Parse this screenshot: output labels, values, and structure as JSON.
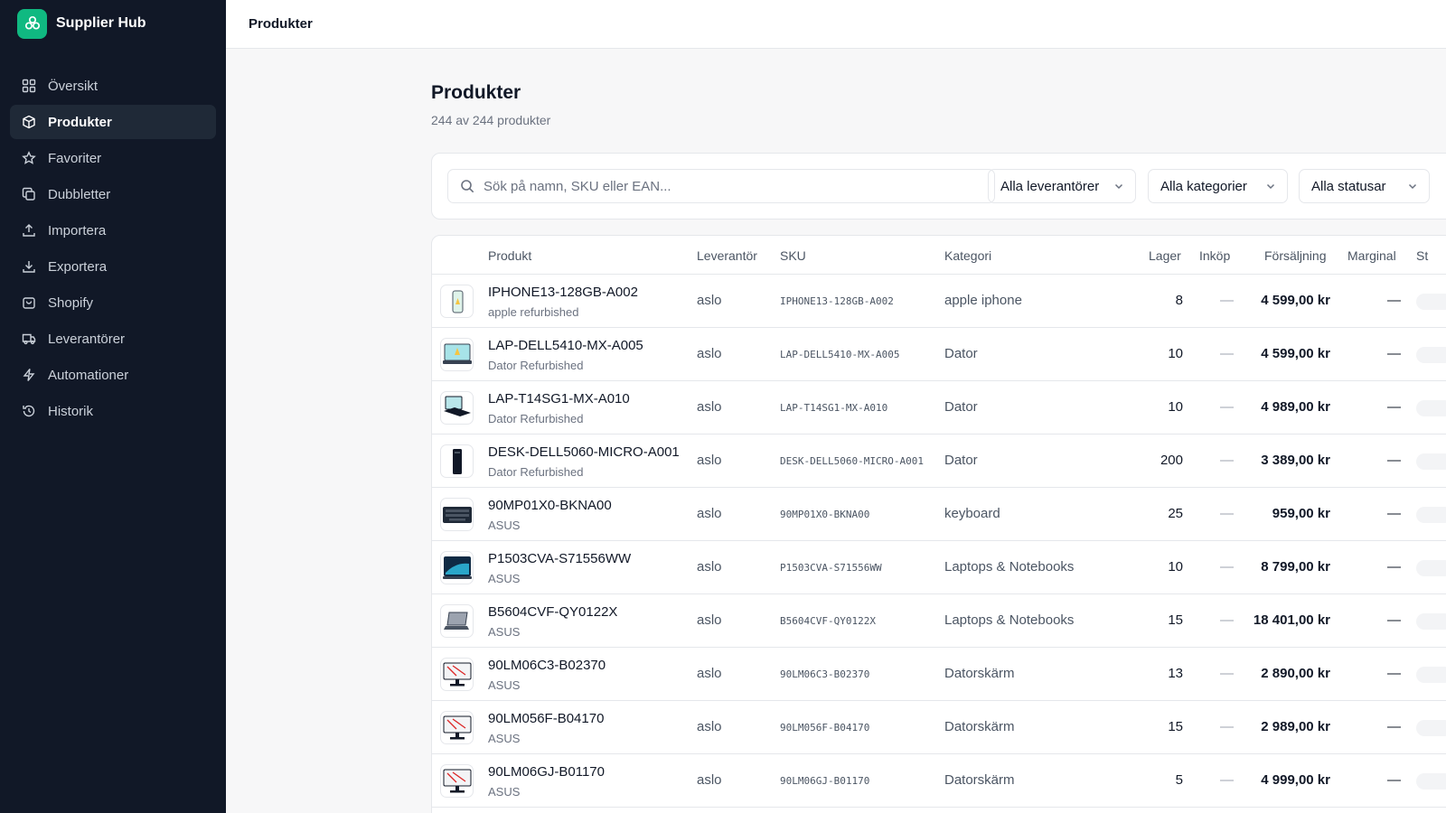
{
  "brand": {
    "name": "Supplier Hub"
  },
  "nav": [
    {
      "label": "Översikt",
      "icon": "grid-icon",
      "active": false
    },
    {
      "label": "Produkter",
      "icon": "package-icon",
      "active": true
    },
    {
      "label": "Favoriter",
      "icon": "star-icon",
      "active": false
    },
    {
      "label": "Dubbletter",
      "icon": "copy-icon",
      "active": false
    },
    {
      "label": "Importera",
      "icon": "upload-icon",
      "active": false
    },
    {
      "label": "Exportera",
      "icon": "download-icon",
      "active": false
    },
    {
      "label": "Shopify",
      "icon": "shopping-bag-icon",
      "active": false
    },
    {
      "label": "Leverantörer",
      "icon": "truck-icon",
      "active": false
    },
    {
      "label": "Automationer",
      "icon": "zap-icon",
      "active": false
    },
    {
      "label": "Historik",
      "icon": "history-icon",
      "active": false
    }
  ],
  "topbar": {
    "title": "Produkter"
  },
  "page": {
    "title": "Produkter",
    "subtitle": "244 av 244 produkter"
  },
  "filters": {
    "search_placeholder": "Sök på namn, SKU eller EAN...",
    "supplier": "Alla leverantörer",
    "category": "Alla kategorier",
    "status": "Alla statusar"
  },
  "columns": {
    "product": "Produkt",
    "supplier": "Leverantör",
    "sku": "SKU",
    "category": "Kategori",
    "stock": "Lager",
    "purchase": "Inköp",
    "price": "Försäljning",
    "margin": "Marginal",
    "status": "St"
  },
  "rows": [
    {
      "name": "IPHONE13-128GB-A002",
      "brand": "apple refurbished",
      "supplier": "aslo",
      "sku": "IPHONE13-128GB-A002",
      "category": "apple iphone",
      "stock": "8",
      "purchase": "—",
      "price": "4 599,00 kr",
      "margin": "—",
      "thumb": "phone"
    },
    {
      "name": "LAP-DELL5410-MX-A005",
      "brand": "Dator Refurbished",
      "supplier": "aslo",
      "sku": "LAP-DELL5410-MX-A005",
      "category": "Dator",
      "stock": "10",
      "purchase": "—",
      "price": "4 599,00 kr",
      "margin": "—",
      "thumb": "laptop-teal"
    },
    {
      "name": "LAP-T14SG1-MX-A010",
      "brand": "Dator Refurbished",
      "supplier": "aslo",
      "sku": "LAP-T14SG1-MX-A010",
      "category": "Dator",
      "stock": "10",
      "purchase": "—",
      "price": "4 989,00 kr",
      "margin": "—",
      "thumb": "laptop-dark"
    },
    {
      "name": "DESK-DELL5060-MICRO-A001",
      "brand": "Dator Refurbished",
      "supplier": "aslo",
      "sku": "DESK-DELL5060-MICRO-A001",
      "category": "Dator",
      "stock": "200",
      "purchase": "—",
      "price": "3 389,00 kr",
      "margin": "—",
      "thumb": "tower"
    },
    {
      "name": "90MP01X0-BKNA00",
      "brand": "ASUS",
      "supplier": "aslo",
      "sku": "90MP01X0-BKNA00",
      "category": "keyboard",
      "stock": "25",
      "purchase": "—",
      "price": "959,00 kr",
      "margin": "—",
      "thumb": "keyboard"
    },
    {
      "name": "P1503CVA-S71556WW",
      "brand": "ASUS",
      "supplier": "aslo",
      "sku": "P1503CVA-S71556WW",
      "category": "Laptops & Notebooks",
      "stock": "10",
      "purchase": "—",
      "price": "8 799,00 kr",
      "margin": "—",
      "thumb": "laptop-blue"
    },
    {
      "name": "B5604CVF-QY0122X",
      "brand": "ASUS",
      "supplier": "aslo",
      "sku": "B5604CVF-QY0122X",
      "category": "Laptops & Notebooks",
      "stock": "15",
      "purchase": "—",
      "price": "18 401,00 kr",
      "margin": "—",
      "thumb": "laptop-grey"
    },
    {
      "name": "90LM06C3-B02370",
      "brand": "ASUS",
      "supplier": "aslo",
      "sku": "90LM06C3-B02370",
      "category": "Datorskärm",
      "stock": "13",
      "purchase": "—",
      "price": "2 890,00 kr",
      "margin": "—",
      "thumb": "monitor"
    },
    {
      "name": "90LM056F-B04170",
      "brand": "ASUS",
      "supplier": "aslo",
      "sku": "90LM056F-B04170",
      "category": "Datorskärm",
      "stock": "15",
      "purchase": "—",
      "price": "2 989,00 kr",
      "margin": "—",
      "thumb": "monitor"
    },
    {
      "name": "90LM06GJ-B01170",
      "brand": "ASUS",
      "supplier": "aslo",
      "sku": "90LM06GJ-B01170",
      "category": "Datorskärm",
      "stock": "5",
      "purchase": "—",
      "price": "4 999,00 kr",
      "margin": "—",
      "thumb": "monitor"
    }
  ]
}
